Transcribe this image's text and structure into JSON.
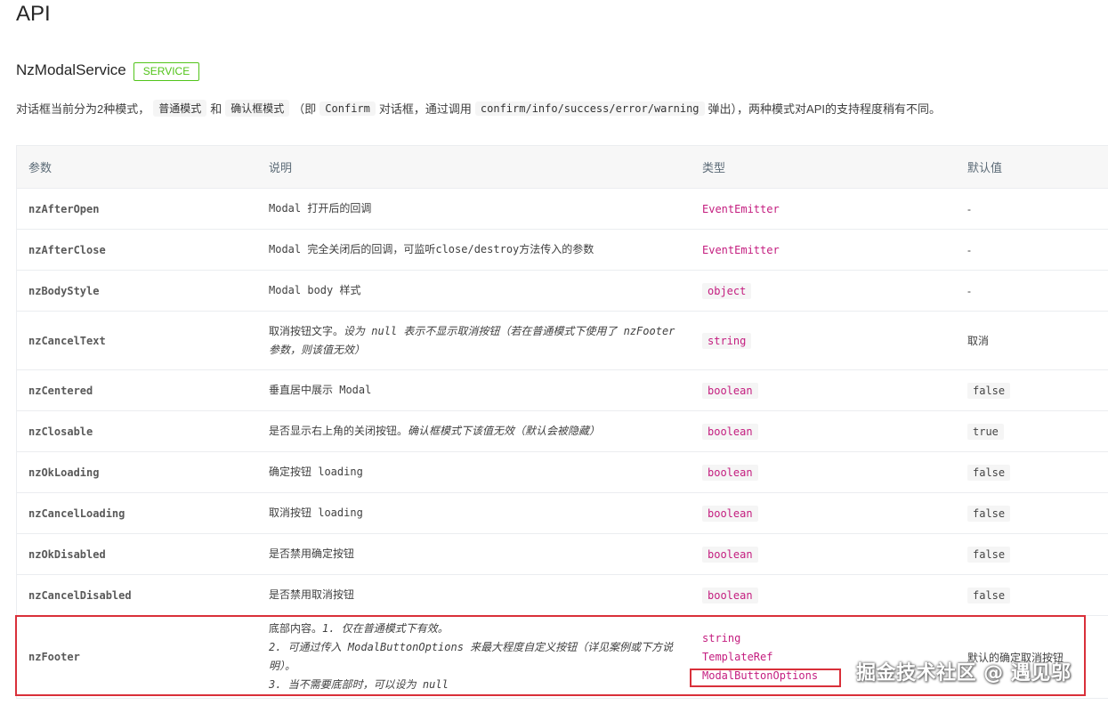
{
  "page": {
    "title": "API"
  },
  "service": {
    "name": "NzModalService",
    "badge": "SERVICE"
  },
  "intro": {
    "prefix": "对话框当前分为2种模式，",
    "mode_normal": "普通模式",
    "and_text": "和",
    "mode_confirm": "确认框模式",
    "paren_open": "（即",
    "confirm_code": "Confirm",
    "dialog_text": "对话框，通过调用",
    "methods_code": "confirm/info/success/error/warning",
    "suffix": "弹出），两种模式对API的支持程度稍有不同。"
  },
  "table": {
    "headers": {
      "param": "参数",
      "desc": "说明",
      "type": "类型",
      "default": "默认值"
    },
    "rows": [
      {
        "param": "nzAfterOpen",
        "desc": "Modal 打开后的回调",
        "type": "EventEmitter",
        "default": "-"
      },
      {
        "param": "nzAfterClose",
        "desc": "Modal 完全关闭后的回调，可监听close/destroy方法传入的参数",
        "type": "EventEmitter",
        "default": "-"
      },
      {
        "param": "nzBodyStyle",
        "desc": "Modal body 样式",
        "type": "object",
        "default": "-"
      },
      {
        "param": "nzCancelText",
        "desc": "取消按钮文字。",
        "desc_em": "设为 null 表示不显示取消按钮（若在普通模式下使用了 nzFooter 参数，则该值无效）",
        "type": "string",
        "default": "取消"
      },
      {
        "param": "nzCentered",
        "desc": "垂直居中展示 Modal",
        "type": "boolean",
        "default": "false"
      },
      {
        "param": "nzClosable",
        "desc": "是否显示右上角的关闭按钮。",
        "desc_em": "确认框模式下该值无效（默认会被隐藏）",
        "type": "boolean",
        "default": "true"
      },
      {
        "param": "nzOkLoading",
        "desc": "确定按钮 loading",
        "type": "boolean",
        "default": "false"
      },
      {
        "param": "nzCancelLoading",
        "desc": "取消按钮 loading",
        "type": "boolean",
        "default": "false"
      },
      {
        "param": "nzOkDisabled",
        "desc": "是否禁用确定按钮",
        "type": "boolean",
        "default": "false"
      },
      {
        "param": "nzCancelDisabled",
        "desc": "是否禁用取消按钮",
        "type": "boolean",
        "default": "false"
      },
      {
        "param": "nzFooter",
        "desc": "底部内容。",
        "desc_em_1": "1. 仅在普通模式下有效。",
        "desc_em_2": "2. 可通过传入 ModalButtonOptions 来最大程度自定义按钮（详见案例或下方说明）。",
        "desc_em_3": "3. 当不需要底部时，可以设为 null",
        "types": [
          "string",
          "TemplateRef",
          "ModalButtonOptions"
        ],
        "default": "默认的确定取消按钮"
      }
    ]
  },
  "watermark": "掘金技术社区 @ 遇见邬",
  "colors": {
    "accent_green": "#52c41a",
    "type_magenta": "#c41d7f",
    "highlight_red": "#d9303a",
    "header_bg": "#f7f7f7",
    "border": "#ebedf0"
  }
}
